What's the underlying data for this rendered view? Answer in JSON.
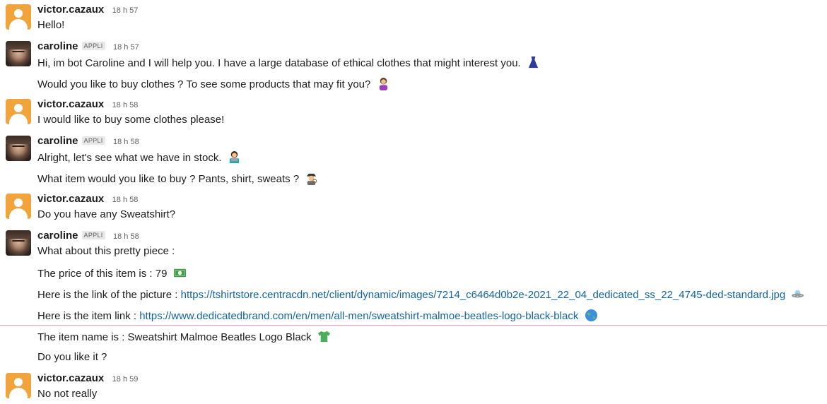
{
  "messages": [
    {
      "user": "victor.cazaux",
      "time": "18 h 57",
      "lines": [
        "Hello!"
      ]
    },
    {
      "user": "caroline",
      "badge": "APPLI",
      "time": "18 h 57",
      "lines": [
        "Hi, im bot Caroline and I will help you. I have a large database of ethical clothes that might interest you.",
        "Would you like to buy clothes ? To see some products that may fit you?"
      ]
    },
    {
      "user": "victor.cazaux",
      "time": "18 h 58",
      "lines": [
        "I would like to buy some clothes please!"
      ]
    },
    {
      "user": "caroline",
      "badge": "APPLI",
      "time": "18 h 58",
      "lines": [
        "Alright, let's see what we have in stock.",
        "What item would you like to buy ? Pants, shirt, sweats ?"
      ]
    },
    {
      "user": "victor.cazaux",
      "time": "18 h 58",
      "lines": [
        "Do you have any Sweatshirt?"
      ]
    },
    {
      "user": "caroline",
      "badge": "APPLI",
      "time": "18 h 58",
      "lines": [
        "What about this pretty piece :",
        "The price of this item is : 79",
        "Here is the link of the picture  : ",
        "Here is the item link : ",
        "The item name is : Sweatshirt Malmoe Beatles Logo Black",
        "Do you like it ?"
      ],
      "picture_url": "https://tshirtstore.centracdn.net/client/dynamic/images/7214_c6464d0b2e-2021_22_04_dedicated_ss_22_4745-ded-standard.jpg",
      "item_url": "https://www.dedicatedbrand.com/en/men/all-men/sweatshirt-malmoe-beatles-logo-black-black"
    },
    {
      "user": "victor.cazaux",
      "time": "18 h 59",
      "lines": [
        "No not really"
      ]
    }
  ],
  "icons": {
    "dress": "dress-emoji-icon",
    "woman_tipping_hand": "woman-tipping-hand-emoji-icon",
    "technologist": "technologist-emoji-icon",
    "detective": "detective-emoji-icon",
    "money": "dollar-banknote-emoji-icon",
    "ufo": "flying-saucer-emoji-icon",
    "globe": "globe-emoji-icon",
    "tshirt": "tshirt-emoji-icon"
  },
  "colors": {
    "link": "#1264a3",
    "avatar_default": "#f2a43c",
    "divider": "#e8a0bf"
  }
}
